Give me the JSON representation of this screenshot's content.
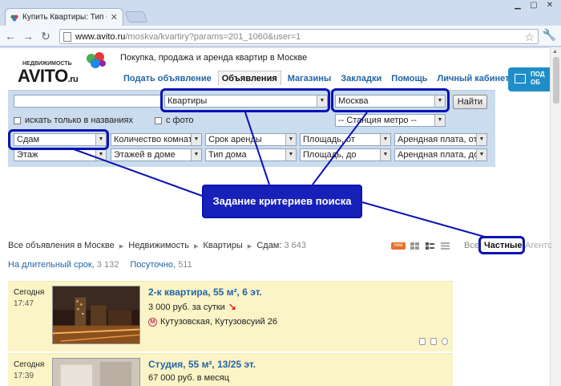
{
  "browser": {
    "tab_title": "Купить Квартиры: Тип объ",
    "url_domain": "www.avito.ru",
    "url_path": "/moskva/kvartiry?params=201_1060&user=1"
  },
  "site": {
    "logo_top": "НЕДВИЖИМОСТЬ",
    "logo_main": "AVITO",
    "logo_ru": ".ru",
    "tagline": "Покупка, продажа и аренда квартир в Москве",
    "menu": [
      {
        "label": "Подать объявление"
      },
      {
        "label": "Объявления"
      },
      {
        "label": "Магазины"
      },
      {
        "label": "Закладки"
      },
      {
        "label": "Помощь"
      },
      {
        "label": "Личный кабинет"
      }
    ],
    "ad_banner_text": "ПОД ОБ"
  },
  "search": {
    "query": "",
    "category": "Квартиры",
    "city": "Москва",
    "find_button": "Найти",
    "only_titles": "искать только в названиях",
    "with_photo": "с фото",
    "metro": "-- Станция метро --",
    "row1": [
      "Сдам",
      "Количество комнат",
      "Срок аренды",
      "Площадь, от",
      "Арендная плата, от"
    ],
    "row2": [
      "Этаж",
      "Этажей в доме",
      "Тип дома",
      "Площадь, до",
      "Арендная плата, до"
    ]
  },
  "annotation": {
    "label": "Задание критериев поиска"
  },
  "results": {
    "crumbs": [
      "Все объявления в Москве",
      "Недвижимость",
      "Квартиры",
      "Сдам"
    ],
    "count": "3 643",
    "new_badge": "new",
    "filter_all": "Все",
    "filter_private": "Частные",
    "filter_agent": "Агентс",
    "subfilter_long": "На длительный срок",
    "subfilter_long_count": "3 132",
    "subfilter_daily": "Посуточно",
    "subfilter_daily_count": "511"
  },
  "listings": [
    {
      "date": "Сегодня",
      "time": "17:47",
      "title": "2-к квартира, 55 м², 6 эт.",
      "price": "3 000 руб. за сутки",
      "metro": "Кутузовская, Кутузовсуий 26"
    },
    {
      "date": "Сегодня",
      "time": "17:39",
      "title": "Студия, 55 м², 13/25 эт.",
      "price": "67 000 руб. в месяц",
      "metro": ""
    }
  ],
  "colors": {
    "link": "#2264a6",
    "panel": "#cadcee",
    "annotation": "#0a13b4",
    "listing_bg": "#fbf4c6"
  }
}
